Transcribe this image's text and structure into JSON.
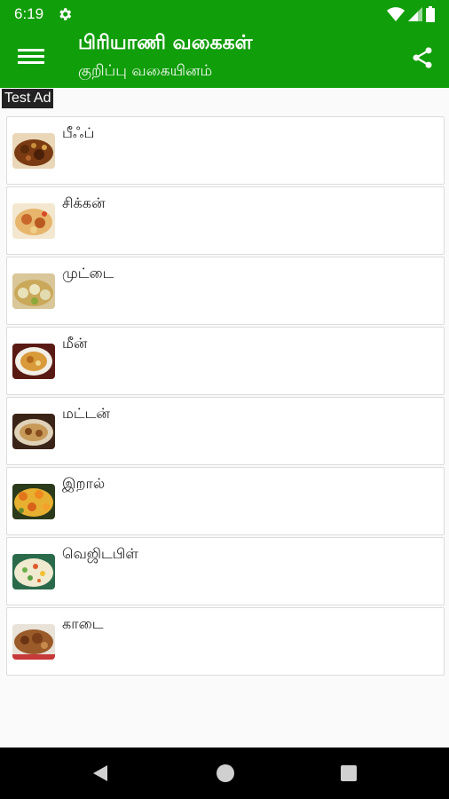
{
  "status": {
    "time": "6:19"
  },
  "app": {
    "title": "பிரியாணி வகைகள்",
    "subtitle": "குறிப்பு வகையினம்"
  },
  "ad": {
    "label": "Test Ad"
  },
  "items": [
    {
      "label": "பீஃப்",
      "icon": "beef-biryani-image"
    },
    {
      "label": "சிக்கன்",
      "icon": "chicken-biryani-image"
    },
    {
      "label": "முட்டை",
      "icon": "egg-biryani-image"
    },
    {
      "label": "மீன்",
      "icon": "fish-biryani-image"
    },
    {
      "label": "மட்டன்",
      "icon": "mutton-biryani-image"
    },
    {
      "label": "இறால்",
      "icon": "prawn-biryani-image"
    },
    {
      "label": "வெஜிடபிள்",
      "icon": "vegetable-biryani-image"
    },
    {
      "label": "காடை",
      "icon": "quail-biryani-image"
    }
  ],
  "colors": {
    "primary": "#119e0b",
    "background": "#fafafa",
    "card": "#ffffff"
  }
}
